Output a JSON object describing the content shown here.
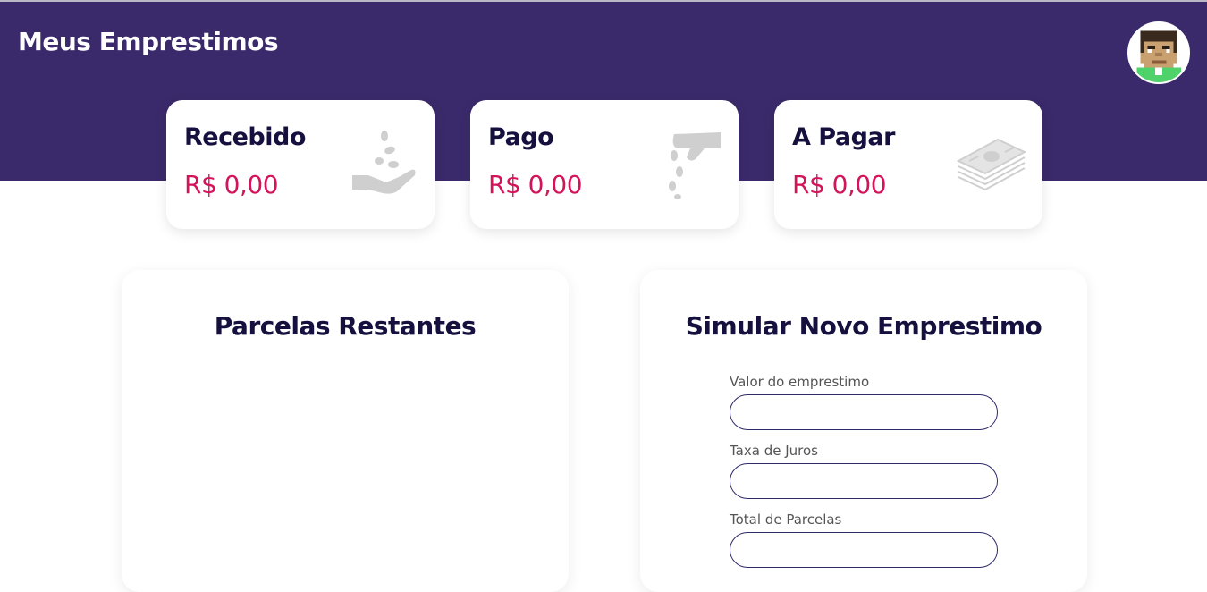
{
  "header": {
    "title": "Meus Emprestimos"
  },
  "colors": {
    "header_bg": "#3b2a6b",
    "accent_value": "#d4145a",
    "heading": "#15103e",
    "input_border": "#2e2a6b"
  },
  "cards": [
    {
      "label": "Recebido",
      "value": "R$ 0,00",
      "icon": "hand-receiving-coins-icon"
    },
    {
      "label": "Pago",
      "value": "R$ 0,00",
      "icon": "hand-dropping-coins-icon"
    },
    {
      "label": "A Pagar",
      "value": "R$ 0,00",
      "icon": "money-stack-icon"
    }
  ],
  "panels": {
    "installments": {
      "title": "Parcelas Restantes"
    },
    "simulator": {
      "title": "Simular Novo Emprestimo",
      "fields": [
        {
          "label": "Valor do emprestimo",
          "value": ""
        },
        {
          "label": "Taxa de Juros",
          "value": ""
        },
        {
          "label": "Total de Parcelas",
          "value": ""
        }
      ]
    }
  }
}
